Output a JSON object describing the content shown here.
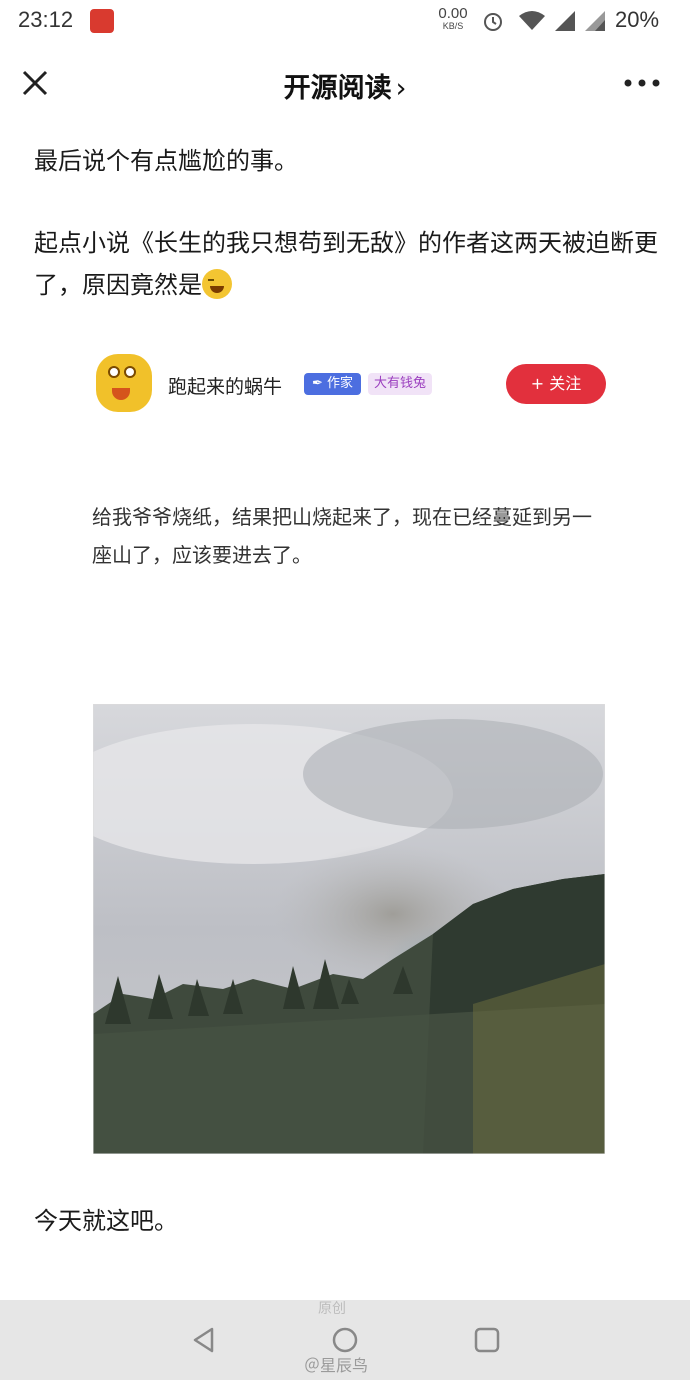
{
  "status_bar": {
    "time": "23:12",
    "net_speed_value": "0.00",
    "net_speed_unit": "KB/S",
    "battery": "20%"
  },
  "nav": {
    "title": "开源阅读",
    "chevron": "›",
    "close_icon": "close-icon",
    "more_icon": "more-icon"
  },
  "article": {
    "para1": "最后说个有点尴尬的事。",
    "para2": "起点小说《长生的我只想苟到无敌》的作者这两天被迫断更了，原因竟然是",
    "post": {
      "username": "跑起来的蜗牛",
      "writer_badge": "✒ 作家",
      "vip_badge": "大有钱兔",
      "follow_label": "+ 关注",
      "text": "给我爷爷烧纸，结果把山烧起来了，现在已经蔓延到另一座山了，应该要进去了。"
    },
    "para3": "今天就这吧。"
  },
  "bottom_bar": {
    "ghost_text": "原创",
    "watermark": "＠星辰鸟"
  },
  "colors": {
    "follow": "#e2303d",
    "writer_badge": "#4c6ee0",
    "vip_badge_text": "#9b3fbf"
  }
}
